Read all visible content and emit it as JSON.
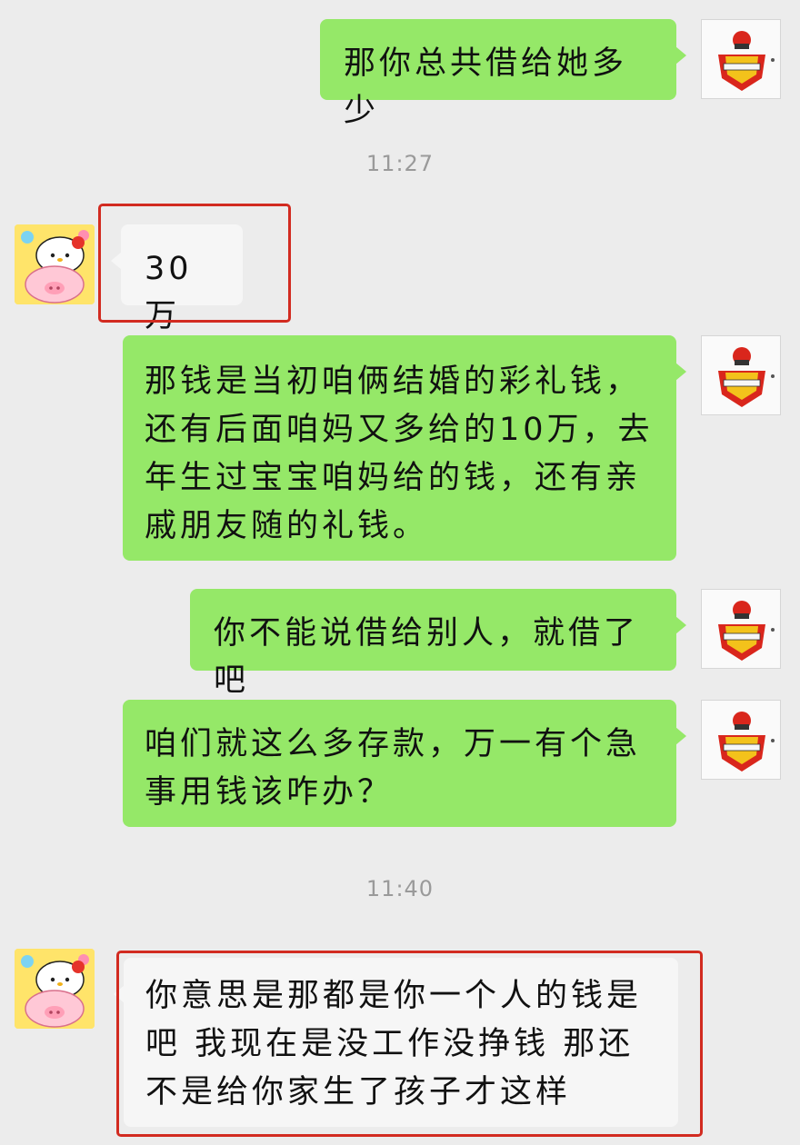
{
  "messages": [
    {
      "from": "me",
      "text": "那你总共借给她多少",
      "avatar": "shield-mascot-icon"
    },
    {
      "type": "time",
      "text": "11:27"
    },
    {
      "from": "her",
      "text": "30万",
      "avatar": "hello-kitty-pig-icon",
      "highlighted": true
    },
    {
      "from": "me",
      "text": "那钱是当初咱俩结婚的彩礼钱，还有后面咱妈又多给的10万，去年生过宝宝咱妈给的钱，还有亲戚朋友随的礼钱。",
      "avatar": "shield-mascot-icon"
    },
    {
      "from": "me",
      "text": "你不能说借给别人，就借了吧",
      "avatar": "shield-mascot-icon"
    },
    {
      "from": "me",
      "text": "咱们就这么多存款，万一有个急事用钱该咋办？",
      "avatar": "shield-mascot-icon"
    },
    {
      "type": "time",
      "text": "11:40"
    },
    {
      "from": "her",
      "text": "你意思是那都是你一个人的钱是吧 我现在是没工作没挣钱 那还不是给你家生了孩子才这样",
      "avatar": "hello-kitty-pig-icon",
      "highlighted": true
    }
  ],
  "colors": {
    "background": "#ececec",
    "outgoing_bubble": "#95e868",
    "incoming_bubble": "#f6f6f6",
    "highlight": "#d22b20",
    "timestamp": "#9a9a9a"
  }
}
